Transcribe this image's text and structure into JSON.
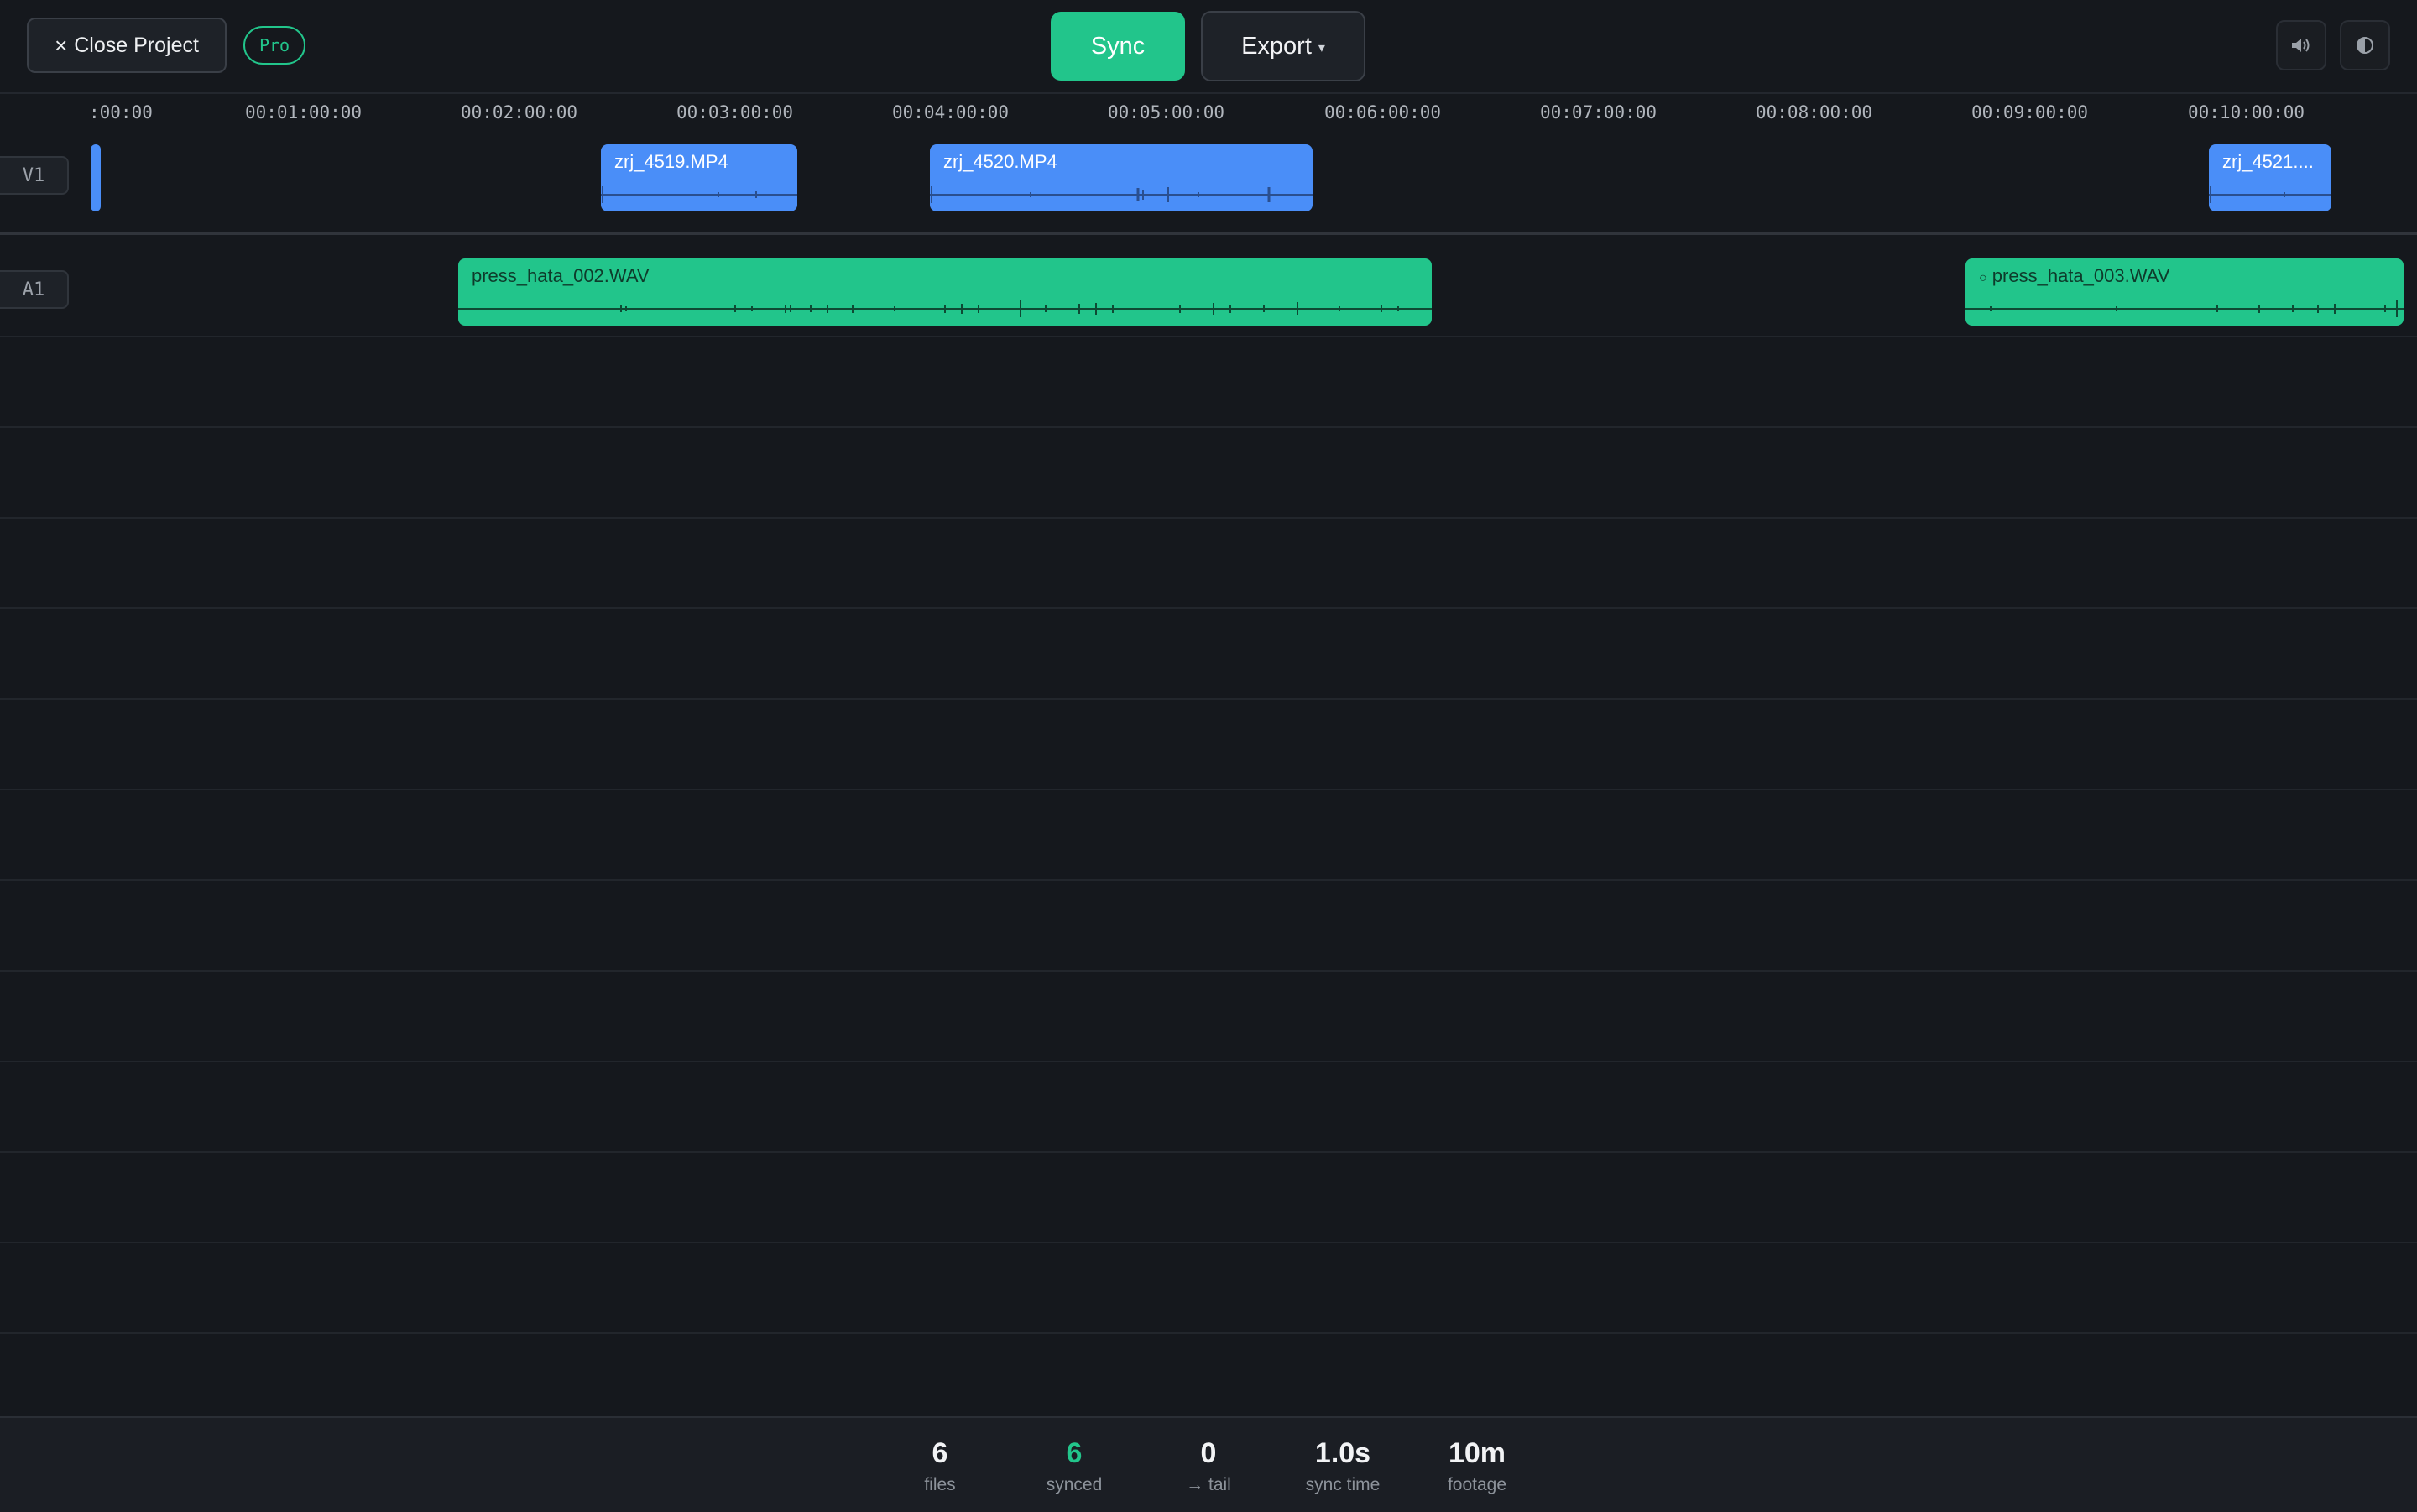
{
  "toolbar": {
    "close_label": "Close Project",
    "close_icon": "×",
    "badge": "Pro",
    "sync_label": "Sync",
    "export_label": "Export",
    "export_caret": "▾",
    "volume_icon": "🔊",
    "theme_icon": "◐"
  },
  "ruler": {
    "ticks": [
      ":00:00",
      "00:01:00:00",
      "00:02:00:00",
      "00:03:00:00",
      "00:04:00:00",
      "00:05:00:00",
      "00:06:00:00",
      "00:07:00:00",
      "00:08:00:00",
      "00:09:00:00",
      "00:10:00:00"
    ]
  },
  "tracks": {
    "video_label": "V1",
    "audio_label": "A1"
  },
  "clips": {
    "video": [
      {
        "name": ""
      },
      {
        "name": "zrj_4519.MP4"
      },
      {
        "name": "zrj_4520.MP4"
      },
      {
        "name": "zrj_4521...."
      }
    ],
    "audio": [
      {
        "name": "press_hata_002.WAV"
      },
      {
        "name": "press_hata_003.WAV",
        "prefix_icon": "○"
      }
    ]
  },
  "colors": {
    "accent": "#22c58b",
    "video_clip": "#4a8ef8",
    "background": "#15181d"
  },
  "stats": [
    {
      "value": "6",
      "label": "files"
    },
    {
      "value": "6",
      "label": "synced",
      "highlight": true
    },
    {
      "value": "0",
      "label": "→ tail"
    },
    {
      "value": "1.0s",
      "label": "sync time"
    },
    {
      "value": "10m",
      "label": "footage"
    }
  ]
}
